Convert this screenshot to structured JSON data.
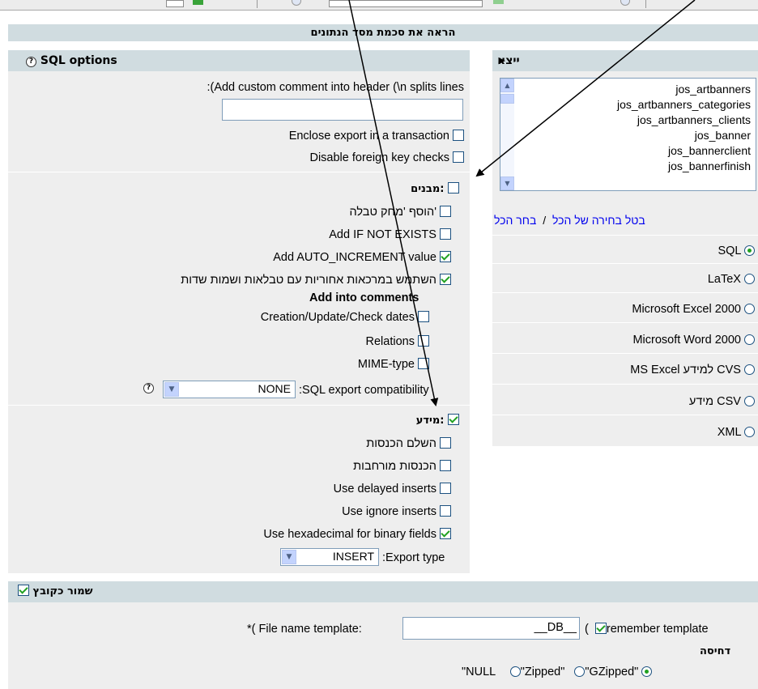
{
  "colors": {
    "header_bg": "#d0dce0",
    "panel_bg": "#eeeeee",
    "check_green": "#21a121",
    "link": "#0000ee"
  },
  "title": "הראה את סכמת מסד הנתונים",
  "export_panel": {
    "header": "ייצא",
    "header_icon": "triangle-right-icon",
    "tables": [
      "jos_artbanners",
      "jos_artbanners_categories",
      "jos_artbanners_clients",
      "jos_banner",
      "jos_bannerclient",
      "jos_bannerfinish"
    ],
    "select_all": "בחר הכל",
    "slash": "/",
    "deselect_all": "בטל בחירה של הכל",
    "formats": [
      {
        "label": "SQL",
        "checked": true
      },
      {
        "label": "LaTeX",
        "checked": false
      },
      {
        "label": "Microsoft Excel 2000",
        "checked": false
      },
      {
        "label": "Microsoft Word 2000",
        "checked": false
      },
      {
        "label": "MS Excel למידע CVS",
        "checked": false
      },
      {
        "label": "מידע CSV",
        "checked": false
      },
      {
        "label": "XML",
        "checked": false
      }
    ]
  },
  "sql_options": {
    "header": "SQL options",
    "header_icon": "help-icon",
    "custom_comment_label": ":(Add custom comment into header (\\n splits lines",
    "custom_comment_value": "",
    "transaction": {
      "label": "Enclose export in a transaction",
      "checked": false
    },
    "foreign_keys": {
      "label": "Disable foreign key checks",
      "checked": false
    },
    "structure": {
      "label": "מבנים:",
      "checked": false
    },
    "add_drop": {
      "label": "הוסף 'מחק טבלה'",
      "checked": false
    },
    "if_not_exists": {
      "label": "Add IF NOT EXISTS",
      "checked": false
    },
    "auto_increment": {
      "label": "Add AUTO_INCREMENT value",
      "checked": true
    },
    "backquotes": {
      "label": "השתמש במרכאות אחוריות עם טבלאות ושמות שדות",
      "checked": true
    },
    "add_comments_heading": "Add into comments",
    "dates": {
      "label": "Creation/Update/Check dates",
      "checked": false
    },
    "relations": {
      "label": "Relations",
      "checked": false
    },
    "mime": {
      "label": "MIME-type",
      "checked": false
    },
    "compat_label": ":SQL export compatibility",
    "compat_value": "NONE",
    "data": {
      "label": "מידע:",
      "checked": true
    },
    "complete_inserts": {
      "label": "השלם הכנסות",
      "checked": false
    },
    "extended_inserts": {
      "label": "הכנסות מורחבות",
      "checked": false
    },
    "delayed": {
      "label": "Use delayed inserts",
      "checked": false
    },
    "ignore": {
      "label": "Use ignore inserts",
      "checked": false
    },
    "hex": {
      "label": "Use hexadecimal for binary fields",
      "checked": true
    },
    "export_type_label": ":Export type",
    "export_type_value": "INSERT"
  },
  "save_file": {
    "label": "שמור כקובץ",
    "checked": true,
    "template_label": "*( File name template:",
    "template_value": "__DB__",
    "paren": "(",
    "remember": {
      "label": "remember template",
      "checked": true
    },
    "compression_heading": "דחיסה",
    "compression": [
      {
        "label": "\"NULL",
        "checked": false
      },
      {
        "label": "\"Zipped\"",
        "checked": false
      },
      {
        "label": "\"GZipped\"",
        "checked": true
      }
    ]
  }
}
